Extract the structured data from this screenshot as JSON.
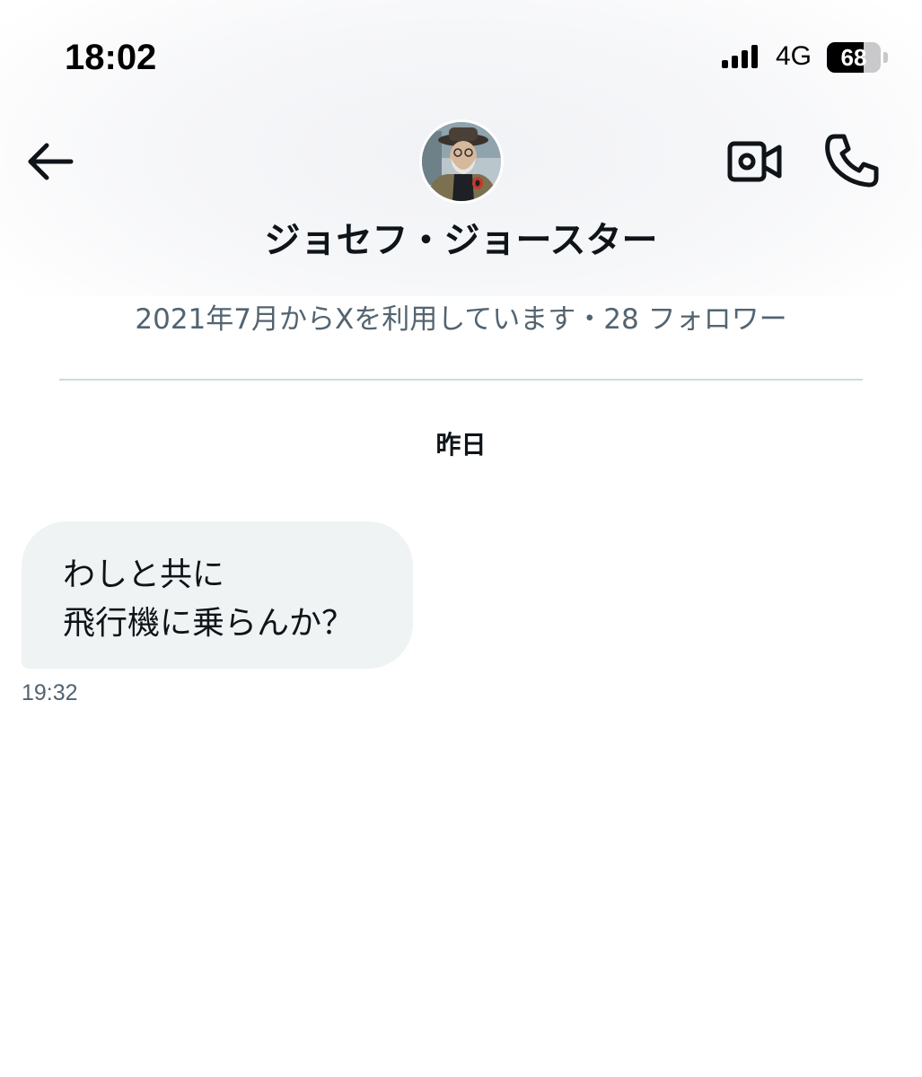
{
  "status_bar": {
    "time": "18:02",
    "network": "4G",
    "battery": "68",
    "battery_level": 0.68
  },
  "header": {
    "back_icon": "arrow-left-icon",
    "video_icon": "video-camera-icon",
    "call_icon": "phone-icon",
    "avatar_label": "avatar"
  },
  "contact": {
    "name": "ジョセフ・ジョースター",
    "meta": "2021年7月からXを利用しています・28 フォロワー"
  },
  "conversation": {
    "date_separator": "昨日",
    "messages": [
      {
        "lines": [
          "わしと共に",
          "飛行機に乗らんか？"
        ],
        "time": "19:32"
      }
    ]
  },
  "colors": {
    "text_primary": "#0f1419",
    "text_secondary": "#536471",
    "bubble_bg": "#eff3f4",
    "divider": "#cfd9de"
  }
}
